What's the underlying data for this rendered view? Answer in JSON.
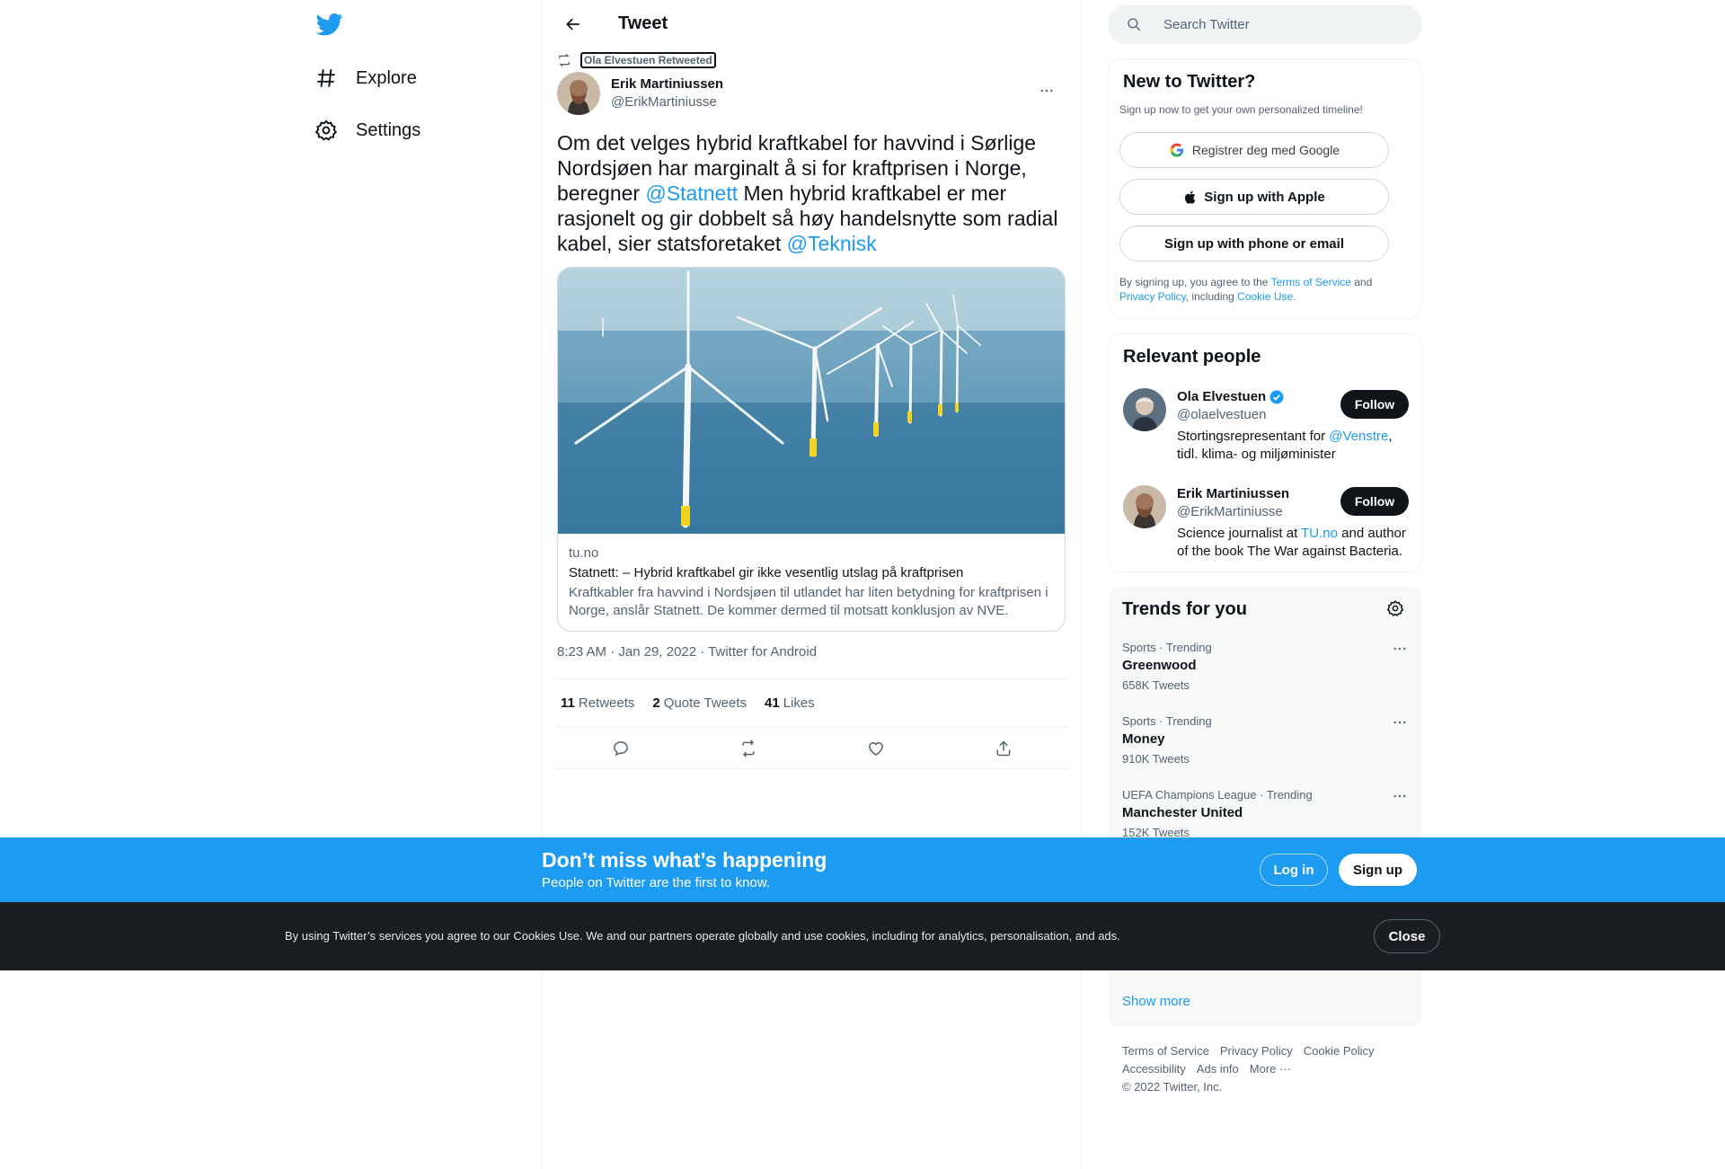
{
  "nav": {
    "logo_icon": "twitter-bird-icon",
    "items": [
      {
        "label": "Explore",
        "icon": "hashtag-icon"
      },
      {
        "label": "Settings",
        "icon": "gear-icon"
      }
    ]
  },
  "header": {
    "title": "Tweet"
  },
  "tweet": {
    "retweeted_by": "Ola Elvestuen Retweeted",
    "author_name": "Erik Martiniussen",
    "author_handle": "@ErikMartiniusse",
    "text_part1": "Om det velges hybrid kraftkabel for havvind i Sørlige Nordsjøen har marginalt å si for kraftprisen i Norge, beregner ",
    "mention1": "@Statnett",
    "text_part2": " Men hybrid kraftkabel er mer rasjonelt og gir dobbelt så høy handelsnytte som radial kabel, sier statsforetaket ",
    "mention2": "@Teknisk",
    "card": {
      "domain": "tu.no",
      "title": "Statnett: – Hybrid kraftkabel gir ikke vesentlig utslag på kraftprisen",
      "description": "Kraftkabler fra havvind i Nordsjøen til utlandet har liten betydning for kraftprisen i Norge, anslår Statnett. De kommer dermed til motsatt konklusjon av NVE."
    },
    "timestamp": "8:23 AM · Jan 29, 2022 · Twitter for Android",
    "stats": {
      "retweets_count": "11",
      "retweets_label": "Retweets",
      "quotes_count": "2",
      "quotes_label": "Quote Tweets",
      "likes_count": "41",
      "likes_label": "Likes"
    }
  },
  "search": {
    "placeholder": "Search Twitter"
  },
  "signup": {
    "title": "New to Twitter?",
    "subtitle": "Sign up now to get your own personalized timeline!",
    "google_label": "Registrer deg med Google",
    "apple_label": "Sign up with Apple",
    "phone_label": "Sign up with phone or email",
    "legal_prefix": "By signing up, you agree to the ",
    "terms_link": "Terms of Service",
    "legal_and": " and ",
    "privacy_link": "Privacy Policy",
    "legal_including": ", including ",
    "cookie_link": "Cookie Use."
  },
  "relevant_people": {
    "title": "Relevant people",
    "people": [
      {
        "name": "Ola Elvestuen",
        "handle": "@olaelvestuen",
        "bio_prefix": "Stortingsrepresentant for ",
        "bio_link": "@Venstre",
        "bio_suffix": ", tidl. klima- og miljøminister",
        "follow_label": "Follow"
      },
      {
        "name": "Erik Martiniussen",
        "handle": "@ErikMartiniusse",
        "bio_prefix": "Science journalist at ",
        "bio_link": "TU.no",
        "bio_suffix": " and author of the book The War against Bacteria.",
        "follow_label": "Follow"
      }
    ]
  },
  "trends": {
    "title": "Trends for you",
    "items": [
      {
        "meta": "Sports · Trending",
        "name": "Greenwood",
        "count": "658K Tweets"
      },
      {
        "meta": "Sports · Trending",
        "name": "Money",
        "count": "910K Tweets"
      },
      {
        "meta": "UEFA Champions League · Trending",
        "name": "Manchester United",
        "count": "152K Tweets"
      }
    ],
    "show_more": "Show more"
  },
  "footer": {
    "links": [
      "Terms of Service",
      "Privacy Policy",
      "Cookie Policy",
      "Accessibility",
      "Ads info",
      "More ···"
    ],
    "copyright": "© 2022 Twitter, Inc."
  },
  "banner": {
    "title": "Don’t miss what’s happening",
    "subtitle": "People on Twitter are the first to know.",
    "login_label": "Log in",
    "signup_label": "Sign up"
  },
  "cookie_bar": {
    "text": "By using Twitter’s services you agree to our Cookies Use. We and our partners operate globally and use cookies, including for analytics, personalisation, and ads.",
    "close_label": "Close"
  },
  "colors": {
    "accent": "#1d9bf0",
    "text": "#0f1419",
    "secondary": "#536471",
    "cookie_bg": "#1a1d21"
  }
}
